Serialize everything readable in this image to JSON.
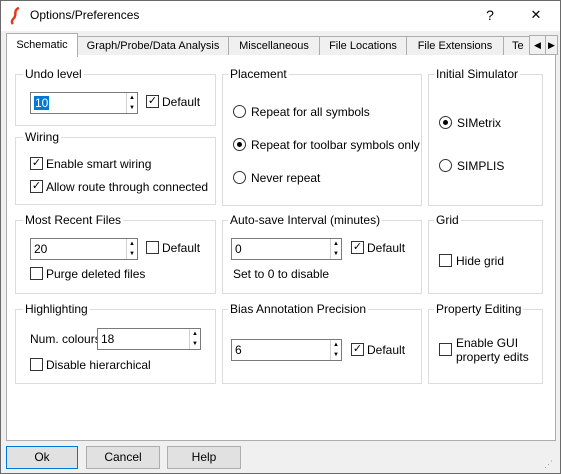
{
  "window": {
    "title": "Options/Preferences",
    "help_button": "?",
    "close_button": "✕",
    "app_icon": "simetrix-logo-icon"
  },
  "tabs": [
    {
      "label": "Schematic",
      "selected": true
    },
    {
      "label": "Graph/Probe/Data Analysis",
      "selected": false
    },
    {
      "label": "Miscellaneous",
      "selected": false
    },
    {
      "label": "File Locations",
      "selected": false
    },
    {
      "label": "File Extensions",
      "selected": false
    },
    {
      "label": "Te",
      "selected": false
    }
  ],
  "tab_scroll": {
    "left": "◀",
    "right": "▶"
  },
  "undo_level": {
    "label": "Undo level",
    "value": "10",
    "default_label": "Default",
    "default_checked": true
  },
  "wiring": {
    "label": "Wiring",
    "enable_smart_wiring": {
      "label": "Enable smart wiring",
      "checked": true
    },
    "allow_route": {
      "label": "Allow route through connected",
      "checked": true
    }
  },
  "most_recent_files": {
    "label": "Most Recent Files",
    "value": "20",
    "default_label": "Default",
    "default_checked": false,
    "purge_label": "Purge deleted files",
    "purge_checked": false
  },
  "highlighting": {
    "label": "Highlighting",
    "num_colours_label": "Num. colours",
    "num_colours_value": "18",
    "disable_hierarchical_label": "Disable hierarchical",
    "disable_hierarchical_checked": false
  },
  "placement": {
    "label": "Placement",
    "options": [
      {
        "label": "Repeat for all symbols",
        "selected": false
      },
      {
        "label": "Repeat for toolbar symbols only",
        "selected": true
      },
      {
        "label": "Never repeat",
        "selected": false
      }
    ]
  },
  "autosave": {
    "label": "Auto-save Interval (minutes)",
    "value": "0",
    "default_label": "Default",
    "default_checked": true,
    "note": "Set to 0 to disable"
  },
  "bias_annotation": {
    "label": "Bias Annotation Precision",
    "value": "6",
    "default_label": "Default",
    "default_checked": true
  },
  "initial_simulator": {
    "label": "Initial Simulator",
    "options": [
      {
        "label": "SIMetrix",
        "selected": true
      },
      {
        "label": "SIMPLIS",
        "selected": false
      }
    ]
  },
  "grid": {
    "label": "Grid",
    "hide_grid_label": "Hide grid",
    "hide_grid_checked": false
  },
  "property_editing": {
    "label": "Property Editing",
    "enable_gui_line1": "Enable GUI",
    "enable_gui_line2": "property edits",
    "checked": false
  },
  "buttons": {
    "ok": "Ok",
    "cancel": "Cancel",
    "help": "Help"
  },
  "check_mark": "✓"
}
